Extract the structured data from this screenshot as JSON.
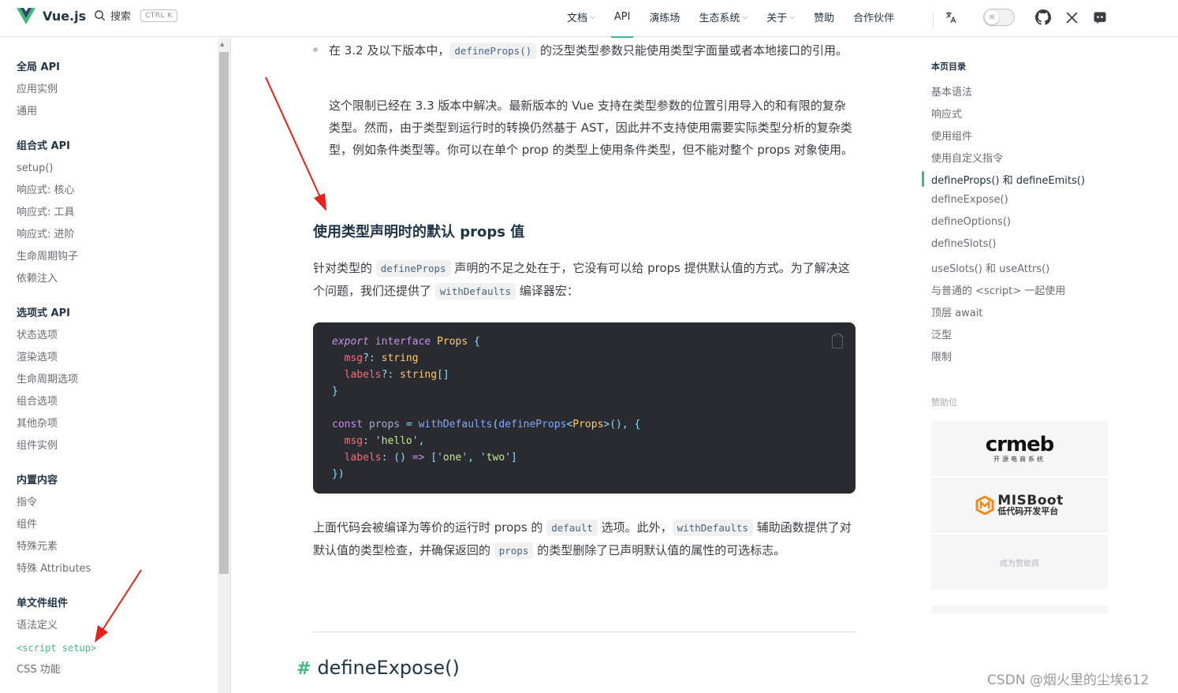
{
  "header": {
    "logo_text": "Vue.js",
    "search_label": "搜索",
    "search_shortcut": "CTRL K",
    "nav": [
      {
        "label": "文档",
        "dropdown": true
      },
      {
        "label": "API",
        "dropdown": false,
        "active": true
      },
      {
        "label": "演练场",
        "dropdown": false
      },
      {
        "label": "生态系统",
        "dropdown": true
      },
      {
        "label": "关于",
        "dropdown": true
      },
      {
        "label": "赞助",
        "dropdown": false
      },
      {
        "label": "合作伙伴",
        "dropdown": false
      }
    ],
    "icons": [
      "translate-icon",
      "theme-toggle",
      "github-icon",
      "x-icon",
      "discord-icon"
    ]
  },
  "sidebar": {
    "groups": [
      {
        "title": "全局 API",
        "items": [
          "应用实例",
          "通用"
        ]
      },
      {
        "title": "组合式 API",
        "items": [
          "setup()",
          "响应式: 核心",
          "响应式: 工具",
          "响应式: 进阶",
          "生命周期钩子",
          "依赖注入"
        ]
      },
      {
        "title": "选项式 API",
        "items": [
          "状态选项",
          "渲染选项",
          "生命周期选项",
          "组合选项",
          "其他杂项",
          "组件实例"
        ]
      },
      {
        "title": "内置内容",
        "items": [
          "指令",
          "组件",
          "特殊元素",
          "特殊 Attributes"
        ]
      },
      {
        "title": "单文件组件",
        "items": [
          "语法定义",
          "<script setup>",
          "CSS 功能"
        ]
      }
    ],
    "active_item": "<script setup>"
  },
  "content": {
    "bullet_1": "在 3.2 及以下版本中，",
    "bullet_code": "defineProps()",
    "bullet_2": " 的泛型类型参数只能使用类型字面量或者本地接口的引用。",
    "limit_para": "这个限制已经在 3.3 版本中解决。最新版本的 Vue 支持在类型参数的位置引用导入的和有限的复杂类型。然而，由于类型到运行时的转换仍然基于 AST，因此并不支持使用需要实际类型分析的复杂类型，例如条件类型等。你可以在单个 prop 的类型上使用条件类型，但不能对整个 props 对象使用。",
    "heading": "使用类型声明时的默认 props 值",
    "p1_a": "针对类型的 ",
    "p1_code1": "defineProps",
    "p1_b": " 声明的不足之处在于，它没有可以给 props 提供默认值的方式。为了解决这个问题，我们还提供了 ",
    "p1_code2": "withDefaults",
    "p1_c": " 编译器宏：",
    "p2_a": "上面代码会被编译为等价的运行时 props 的 ",
    "p2_code1": "default",
    "p2_b": " 选项。此外，",
    "p2_code2": "withDefaults",
    "p2_c": " 辅助函数提供了对默认值的类型检查，并确保返回的 ",
    "p2_code3": "props",
    "p2_d": " 的类型删除了已声明默认值的属性的可选标志。",
    "next_heading_hash": "#",
    "next_heading": "defineExpose()",
    "code_lines": [
      "export interface Props {",
      "  msg?: string",
      "  labels?: string[]",
      "}",
      "",
      "const props = withDefaults(defineProps<Props>(), {",
      "  msg: 'hello',",
      "  labels: () => ['one', 'two']",
      "})"
    ]
  },
  "aside": {
    "toc_title": "本页目录",
    "toc": [
      "基本语法",
      "响应式",
      "使用组件",
      "使用自定义指令",
      "defineProps() 和 defineEmits()",
      "defineExpose()",
      "defineOptions()",
      "defineSlots()",
      "useSlots() 和 useAttrs()",
      "与普通的 <script> 一起使用",
      "顶层 await",
      "泛型",
      "限制"
    ],
    "toc_active_index": 4,
    "sponsor_label": "赞助位",
    "sponsor_1_name": "crmeb",
    "sponsor_1_sub": "开源电商系统",
    "sponsor_2_name": "MISBoot",
    "sponsor_2_sub": "低代码开发平台",
    "become_sponsor": "成为赞助商"
  },
  "watermark": "CSDN @烟火里的尘埃612",
  "colors": {
    "accent": "#42b883",
    "code_bg": "#292b30",
    "annotation_arrow": "#e8211b"
  }
}
